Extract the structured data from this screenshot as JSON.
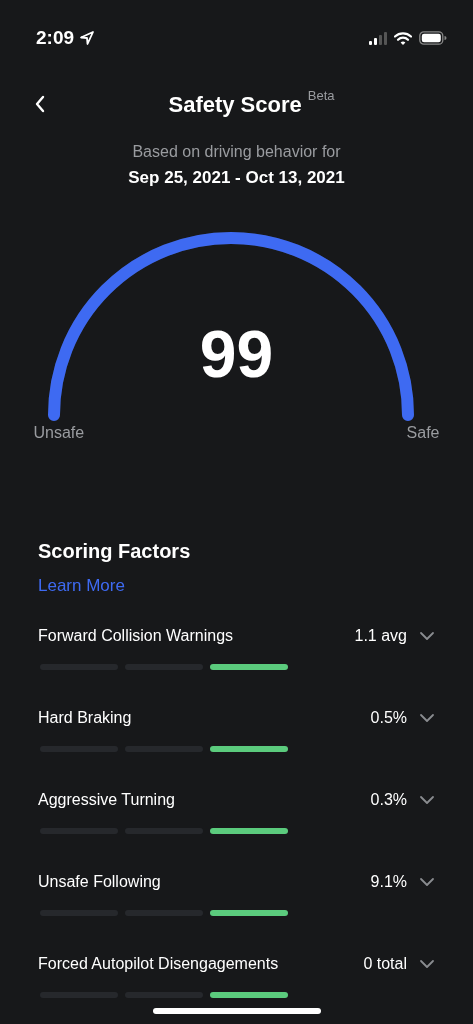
{
  "status_bar": {
    "time": "2:09"
  },
  "header": {
    "title": "Safety Score",
    "badge": "Beta"
  },
  "period": {
    "caption": "Based on driving behavior for",
    "range": "Sep 25, 2021 - Oct 13, 2021"
  },
  "gauge": {
    "score": "99",
    "min_label": "Unsafe",
    "max_label": "Safe"
  },
  "factors_section": {
    "title": "Scoring Factors",
    "link": "Learn More"
  },
  "factors": [
    {
      "name": "Forward Collision Warnings",
      "value": "1.1 avg",
      "expanded": false,
      "segments": [
        {
          "on": false
        },
        {
          "on": false
        },
        {
          "on": true
        }
      ]
    },
    {
      "name": "Hard Braking",
      "value": "0.5%",
      "expanded": false,
      "segments": [
        {
          "on": false
        },
        {
          "on": false
        },
        {
          "on": true
        }
      ]
    },
    {
      "name": "Aggressive Turning",
      "value": "0.3%",
      "expanded": false,
      "segments": [
        {
          "on": false
        },
        {
          "on": false
        },
        {
          "on": true
        }
      ]
    },
    {
      "name": "Unsafe Following",
      "value": "9.1%",
      "expanded": false,
      "segments": [
        {
          "on": false
        },
        {
          "on": false
        },
        {
          "on": true
        }
      ]
    },
    {
      "name": "Forced Autopilot Disengagements",
      "value": "0 total",
      "expanded": false,
      "segments": [
        {
          "on": false
        },
        {
          "on": false
        },
        {
          "on": true
        }
      ]
    }
  ]
}
